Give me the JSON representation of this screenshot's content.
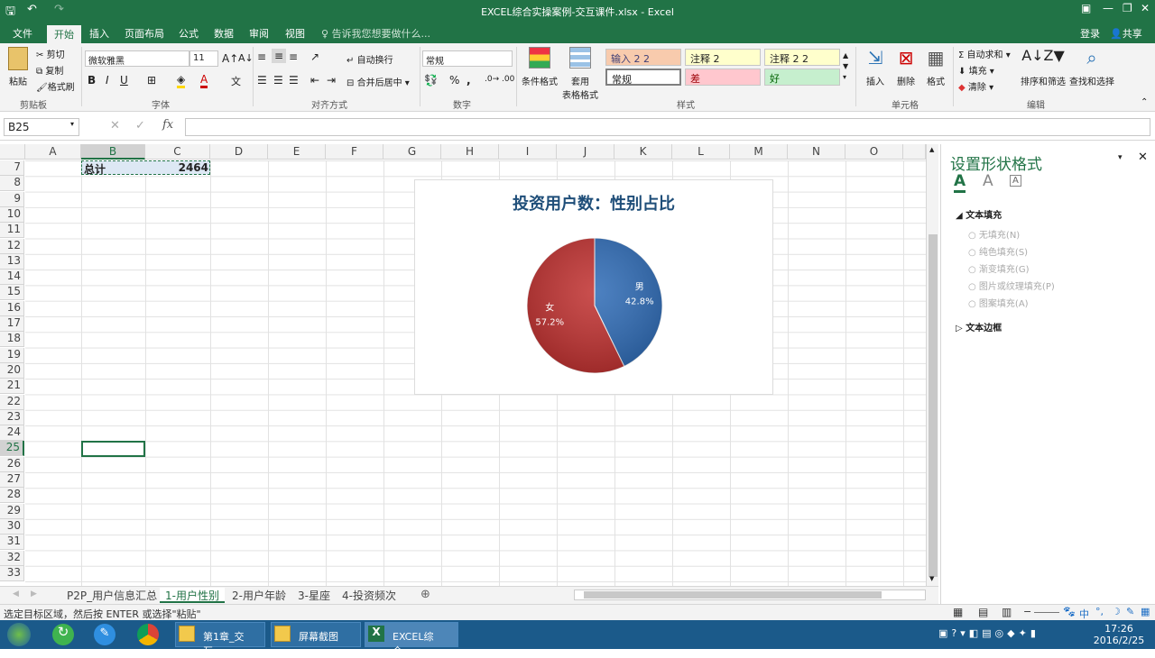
{
  "window": {
    "title": "EXCEL综合实操案例-交互课件.xlsx - Excel"
  },
  "ribbon_tabs": [
    "文件",
    "开始",
    "插入",
    "页面布局",
    "公式",
    "数据",
    "审阅",
    "视图"
  ],
  "tell_me": "告诉我您想要做什么...",
  "account": {
    "login": "登录",
    "share": "共享"
  },
  "clipboard": {
    "paste": "粘贴",
    "cut": "剪切",
    "copy": "复制",
    "format_painter": "格式刷",
    "group": "剪贴板"
  },
  "font": {
    "name": "微软雅黑",
    "size": "11",
    "bold": "B",
    "italic": "I",
    "underline": "U",
    "group": "字体"
  },
  "alignment": {
    "wrap": "自动换行",
    "merge": "合并后居中",
    "group": "对齐方式"
  },
  "number": {
    "format": "常规",
    "percent": "%",
    "comma": ",",
    "group": "数字"
  },
  "styles": {
    "conditional": "条件格式",
    "table1": "套用",
    "table2": "表格格式",
    "input": "输入 2 2",
    "note1": "注释 2",
    "note2": "注释 2 2",
    "normal": "常规",
    "bad": "差",
    "good": "好",
    "group": "样式"
  },
  "cells": {
    "insert": "插入",
    "delete": "删除",
    "format": "格式",
    "group": "单元格"
  },
  "editing": {
    "autosum": "自动求和",
    "fill": "填充",
    "clear": "清除",
    "sort": "排序和筛选",
    "find": "查找和选择",
    "group": "编辑"
  },
  "formula_bar": {
    "name_box": "B25",
    "fx": "fx",
    "formula": ""
  },
  "columns": [
    "A",
    "B",
    "C",
    "D",
    "E",
    "F",
    "G",
    "H",
    "I",
    "J",
    "K",
    "L",
    "M",
    "N",
    "O"
  ],
  "rows": [
    "7",
    "8",
    "9",
    "10",
    "11",
    "12",
    "13",
    "14",
    "15",
    "16",
    "17",
    "18",
    "19",
    "20",
    "21",
    "22",
    "23",
    "24",
    "25",
    "26",
    "27",
    "28",
    "29",
    "30",
    "31",
    "32",
    "33"
  ],
  "sheet_cells": {
    "b7": "总计",
    "c7": "2464"
  },
  "chart_data": {
    "type": "pie",
    "title": "投资用户数：性别占比",
    "categories": [
      "男",
      "女"
    ],
    "values": [
      42.8,
      57.2
    ],
    "labels": [
      "42.8%",
      "57.2%"
    ],
    "colors": [
      "#2e6bb6",
      "#c0302f"
    ]
  },
  "format_pane": {
    "title": "设置形状格式",
    "text_fill": "文本填充",
    "options": [
      "无填充(N)",
      "纯色填充(S)",
      "渐变填充(G)",
      "图片或纹理填充(P)",
      "图案填充(A)"
    ],
    "text_border": "文本边框"
  },
  "sheet_tabs": [
    "P2P_用户信息汇总",
    "1-用户性别",
    "2-用户年龄",
    "3-星座",
    "4-投资频次"
  ],
  "status_text": "选定目标区域，然后按 ENTER 或选择\"粘贴\"",
  "taskbar": {
    "task1": "第1章_交互...",
    "task2": "屏幕截图",
    "task3": "EXCEL综合...",
    "time": "17:26",
    "date": "2016/2/25",
    "ime": "中"
  }
}
